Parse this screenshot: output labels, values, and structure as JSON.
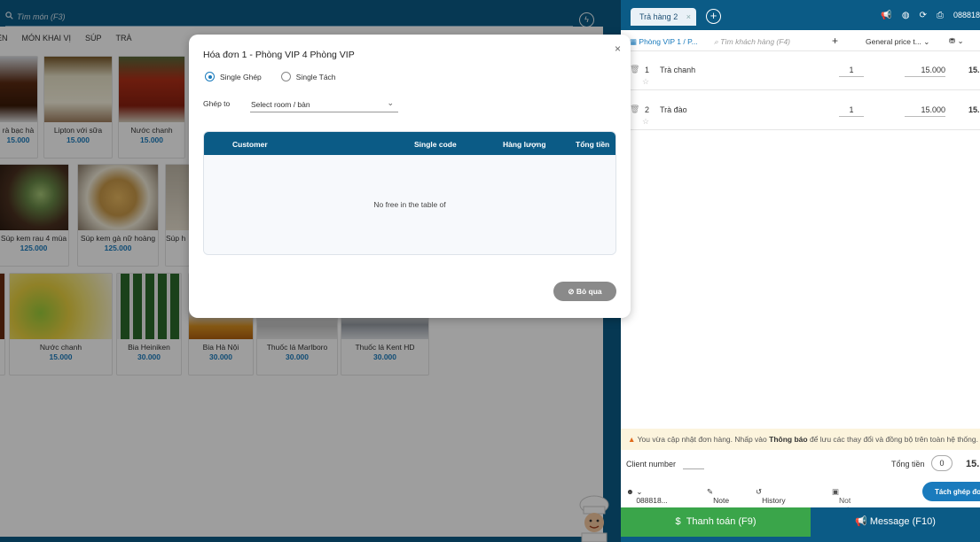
{
  "search": {
    "placeholder": "Tìm món (F3)"
  },
  "categories": [
    "ỀN",
    "MÓN KHAI VỊ",
    "SÚP",
    "TRÀ"
  ],
  "menu_items": [
    {
      "name": "rà bạc hà",
      "price": "15.000"
    },
    {
      "name": "Lipton với sữa",
      "price": "15.000"
    },
    {
      "name": "Nước chanh",
      "price": "15.000"
    },
    {
      "name": "Súp kem rau 4 mùa",
      "price": "125.000"
    },
    {
      "name": "Súp kem gà nữ hoàng",
      "price": "125.000"
    },
    {
      "name": "Súp h",
      "price": ""
    },
    {
      "name": "Nước chanh",
      "price": "15.000"
    },
    {
      "name": "Bia Heiniken",
      "price": "30.000"
    },
    {
      "name": "Bia Hà Nội",
      "price": "30.000"
    },
    {
      "name": "Thuốc lá Marlboro",
      "price": "30.000"
    },
    {
      "name": "Thuốc lá Kent HD",
      "price": "30.000"
    }
  ],
  "order": {
    "tab_label": "Trả hàng 2",
    "room": "Phòng VIP 1 / P...",
    "customer_placeholder": "Tìm khách hàng (F4)",
    "price_list": "General price t...",
    "phone_short": "088818",
    "lines": [
      {
        "index": "1",
        "name": "Trà chanh",
        "qty": "1",
        "price": "15.000",
        "total": "15."
      },
      {
        "index": "2",
        "name": "Trà đào",
        "qty": "1",
        "price": "15.000",
        "total": "15."
      }
    ],
    "notice_pre": "You vừa cập nhật đơn hàng. Nhấp vào",
    "notice_bold": "Thông báo",
    "notice_post": "để lưu các thay đổi và đồng bộ trên toàn hệ thống.",
    "client_label": "Client number",
    "total_label": "Tổng tiền",
    "total_qty": "0",
    "total_value": "15.",
    "customer_phone": "088818...",
    "note_label": "Note",
    "history_label": "History",
    "not_set_label": "Not set before",
    "split_label": "Tách ghép đơn",
    "pay_label": "Thanh toán (F9)",
    "message_label": "Message (F10)"
  },
  "modal": {
    "title": "Hóa đơn 1 - Phòng VIP 4 Phòng VIP",
    "radio_merge": "Single Ghép",
    "radio_split": "Single Tách",
    "merge_to_label": "Ghép to",
    "select_placeholder": "Select room / bàn",
    "columns": [
      "Customer",
      "Single code",
      "Hàng lượng",
      "Tổng tiền"
    ],
    "empty_text": "No free in the table of",
    "skip_label": "Bỏ qua"
  },
  "colors": {
    "primary": "#0b5b86",
    "accent": "#1a7bbd",
    "pay_green": "#3aa54a",
    "skip_gray": "#8a8a8a"
  }
}
